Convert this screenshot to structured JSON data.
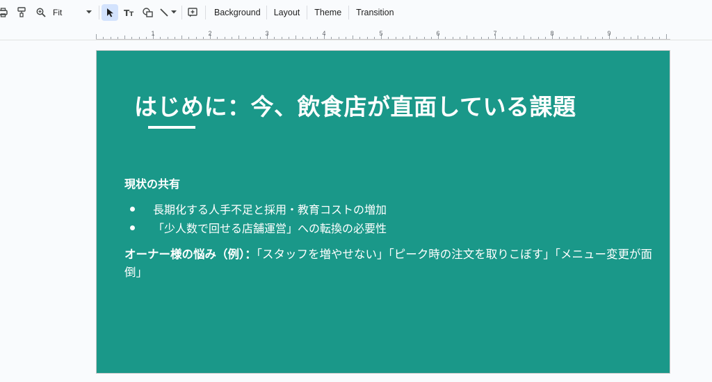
{
  "toolbar": {
    "zoom_label": "Fit",
    "menus": [
      "Background",
      "Layout",
      "Theme",
      "Transition"
    ],
    "icons": [
      "print-icon",
      "paint-format-icon",
      "zoom-icon",
      "cursor-icon",
      "text-box-icon",
      "shape-icon",
      "line-icon",
      "comment-add-icon"
    ]
  },
  "ruler": {
    "labels": [
      "1",
      "2",
      "3",
      "4",
      "5",
      "6",
      "7",
      "8",
      "9"
    ]
  },
  "slide": {
    "title": "はじめに：今、飲食店が直面している課題",
    "section_heading": "現状の共有",
    "bullets": [
      "長期化する人手不足と採用・教育コストの増加",
      "「少人数で回せる店舗運営」への転換の必要性"
    ],
    "concerns_label": "オーナー様の悩み（例）：",
    "concerns_text": "「スタッフを増やせない」「ピーク時の注文を取りこぼす」「メニュー変更が面倒」"
  },
  "colors": {
    "slide_bg": "#1a9889",
    "text": "#ffffff",
    "accent": "#d3e3fd"
  }
}
